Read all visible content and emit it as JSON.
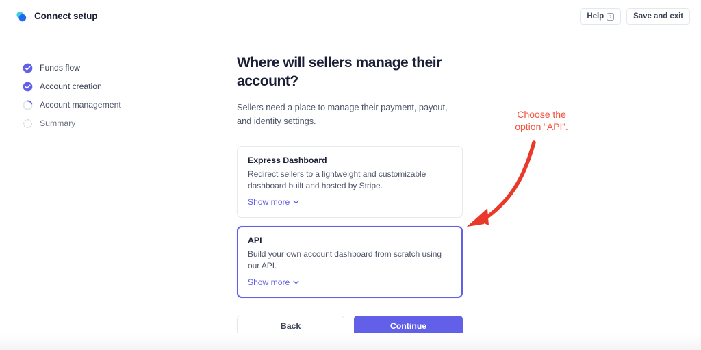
{
  "header": {
    "brand_title": "Connect setup",
    "logo_icon": "stripe-connect-logo-icon",
    "help_label": "Help",
    "help_icon": "question-mark-icon",
    "save_exit_label": "Save and exit"
  },
  "sidebar": {
    "steps": [
      {
        "label": "Funds flow",
        "state": "done",
        "icon": "check-circle-icon"
      },
      {
        "label": "Account creation",
        "state": "done",
        "icon": "check-circle-icon"
      },
      {
        "label": "Account management",
        "state": "current",
        "icon": "spinner-circle-icon"
      },
      {
        "label": "Summary",
        "state": "pending",
        "icon": "dotted-circle-icon"
      }
    ]
  },
  "main": {
    "title": "Where will sellers manage their account?",
    "subtitle": "Sellers need a place to manage their payment, payout, and identity settings.",
    "options": [
      {
        "title": "Express Dashboard",
        "description": "Redirect sellers to a lightweight and customizable dashboard built and hosted by Stripe.",
        "show_more_label": "Show more",
        "selected": false
      },
      {
        "title": "API",
        "description": "Build your own account dashboard from scratch using our API.",
        "show_more_label": "Show more",
        "selected": true
      }
    ],
    "back_label": "Back",
    "continue_label": "Continue"
  },
  "annotation": {
    "text": "Choose the\noption “API”.",
    "color": "#f4533f",
    "arrow_icon": "curved-arrow-icon"
  },
  "colors": {
    "accent_purple": "#6260e8",
    "annotation_red": "#f4533f",
    "text_primary": "#1a1f36",
    "text_secondary": "#4f566b",
    "border": "#e3e8ee"
  }
}
